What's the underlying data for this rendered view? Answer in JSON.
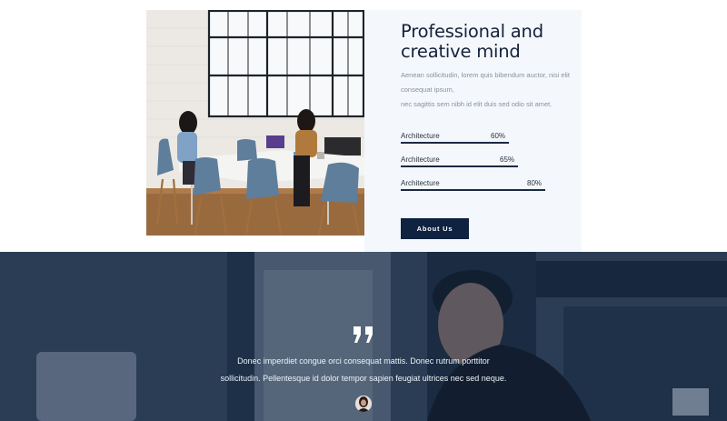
{
  "about": {
    "title_line1": "Professional and",
    "title_line2": "creative mind",
    "description_line1": "Aenean sollicitudin, lorem quis bibendum auctor, nisi elit consequat ipsum,",
    "description_line2": "nec sagittis sem nibh id elit duis sed odio sit amet.",
    "skills": [
      {
        "label": "Architecture",
        "value_text": "60%",
        "percent": 60
      },
      {
        "label": "Architecture",
        "value_text": "65%",
        "percent": 65
      },
      {
        "label": "Architecture",
        "value_text": "80%",
        "percent": 80
      }
    ],
    "button_label": "About Us"
  },
  "testimonial": {
    "quote_line1": "Donec imperdiet congue orci consequat mattis. Donec rutrum porttitor",
    "quote_line2": "sollicitudin. Pellentesque id dolor tempor sapien feugiat ultrices nec sed neque."
  },
  "colors": {
    "navy": "#0f2240",
    "panel_bg": "#f4f8fc",
    "title": "#16213a",
    "muted_text": "#8a909c",
    "overlay": "#182a44"
  },
  "icons": {
    "quote": "quote-icon"
  }
}
